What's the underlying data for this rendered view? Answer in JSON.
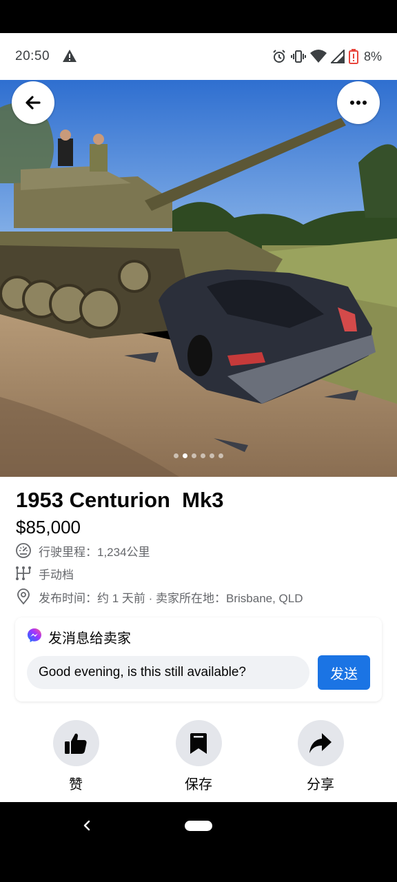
{
  "status_bar": {
    "time": "20:50",
    "battery": "8%",
    "icons": [
      "warning-icon",
      "alarm-icon",
      "vibrate-icon",
      "wifi-icon",
      "signal-icon",
      "battery-icon"
    ]
  },
  "photo": {
    "slide_count": 6,
    "active_slide": 1,
    "back_icon": "arrow-left-icon",
    "more_icon": "more-horizontal-icon"
  },
  "listing": {
    "title": "1953 Centurion  Mk3",
    "price": "$85,000",
    "mileage": "行驶里程：1,234公里",
    "transmission": "手动档",
    "posted": "发布时间：约 1 天前 · 卖家所在地：Brisbane, QLD"
  },
  "message": {
    "header": "发消息给卖家",
    "input_value": "Good evening, is this still available?",
    "send_label": "发送"
  },
  "actions": [
    {
      "label": "赞",
      "icon": "thumbs-up-icon"
    },
    {
      "label": "保存",
      "icon": "bookmark-icon"
    },
    {
      "label": "分享",
      "icon": "share-icon"
    }
  ],
  "colors": {
    "accent": "#1b74e4",
    "secondary_text": "#65676b",
    "input_bg": "#f0f2f5",
    "action_bg": "#e4e6eb"
  }
}
